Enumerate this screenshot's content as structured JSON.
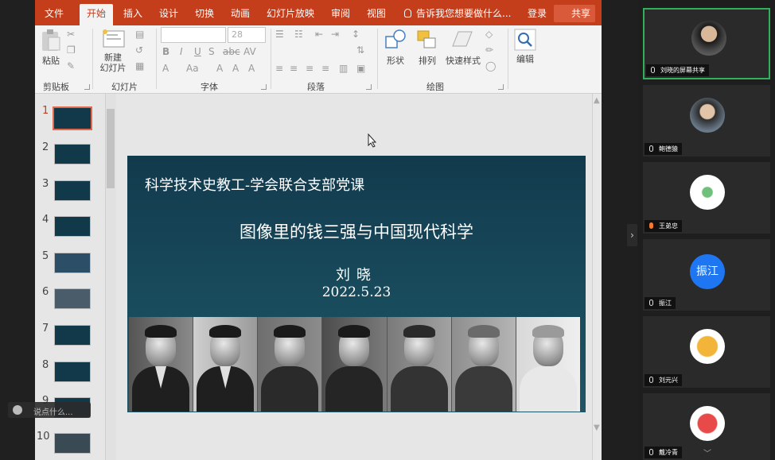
{
  "ribbon_tabs": [
    "文件",
    "开始",
    "插入",
    "设计",
    "切换",
    "动画",
    "幻灯片放映",
    "审阅",
    "视图"
  ],
  "tell_me": "告诉我您想要做什么...",
  "login_label": "登录",
  "share_label": "共享",
  "groups": {
    "clipboard": {
      "label": "剪贴板",
      "paste": "粘贴"
    },
    "slides": {
      "label": "幻灯片",
      "new_slide": "新建\n幻灯片"
    },
    "font": {
      "label": "字体",
      "size": "28"
    },
    "paragraph": {
      "label": "段落"
    },
    "drawing": {
      "label": "绘图",
      "shapes": "形状",
      "arrange": "排列",
      "quick_styles": "快速样式"
    },
    "editing": {
      "label": "编辑"
    }
  },
  "thumbnails": [
    "1",
    "2",
    "3",
    "4",
    "5",
    "6",
    "7",
    "8",
    "9",
    "10"
  ],
  "slide": {
    "subtitle": "科学技术史教工-学会联合支部党课",
    "title": "图像里的钱三强与中国现代科学",
    "author": "刘晓",
    "date": "2022.5.23"
  },
  "participants": [
    {
      "name": "刘晓的屏幕共享",
      "type": "photo"
    },
    {
      "name": "鲍德猿",
      "type": "photo"
    },
    {
      "name": "王弟忠",
      "type": "photo"
    },
    {
      "name": "振江",
      "type": "text",
      "avatar_text": "振江"
    },
    {
      "name": "刘元兴",
      "type": "photo"
    },
    {
      "name": "戴冷青",
      "type": "photo"
    }
  ],
  "chat_placeholder": "说点什么..."
}
